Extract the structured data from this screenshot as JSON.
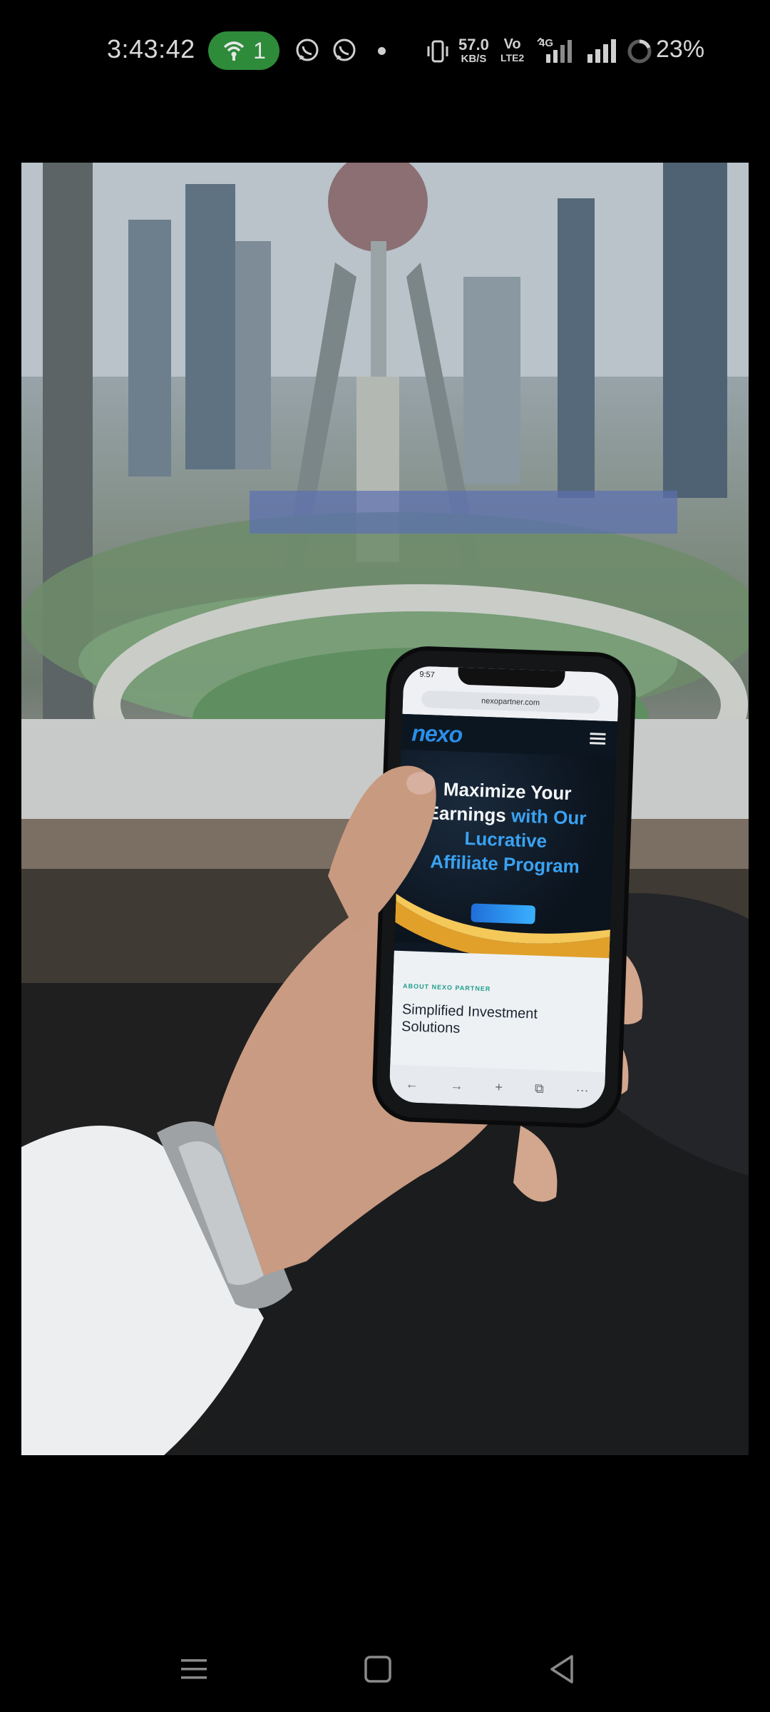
{
  "status_bar": {
    "time": "3:43:42",
    "hotspot_count": "1",
    "net_speed_value": "57.0",
    "net_speed_unit": "KB/S",
    "volte_top": "Vo",
    "volte_bottom": "LTE2",
    "network_type": "4G",
    "battery": "23%",
    "icons": [
      "hotspot-icon",
      "whatsapp-icon",
      "whatsapp-icon",
      "notification-dot",
      "vibrate-icon",
      "signal-icon",
      "battery-ring-icon"
    ]
  },
  "photo": {
    "held_phone": {
      "status_time": "9:57",
      "url": "nexopartner.com",
      "logo": "nexo",
      "hero_line1": "Maximize Your",
      "hero_line2_a": "Earnings",
      "hero_line2_b": " with Our",
      "hero_line3": "Lucrative",
      "hero_line4": "Affiliate Program",
      "about_tag": "ABOUT NEXO PARTNER",
      "about_heading": "Simplified Investment Solutions",
      "toolbar": [
        "←",
        "→",
        "+",
        "⧉",
        "···"
      ]
    }
  },
  "nav_bar": {
    "icons": [
      "menu-icon",
      "home-icon",
      "back-icon"
    ],
    "color": "#8a8a8a"
  }
}
